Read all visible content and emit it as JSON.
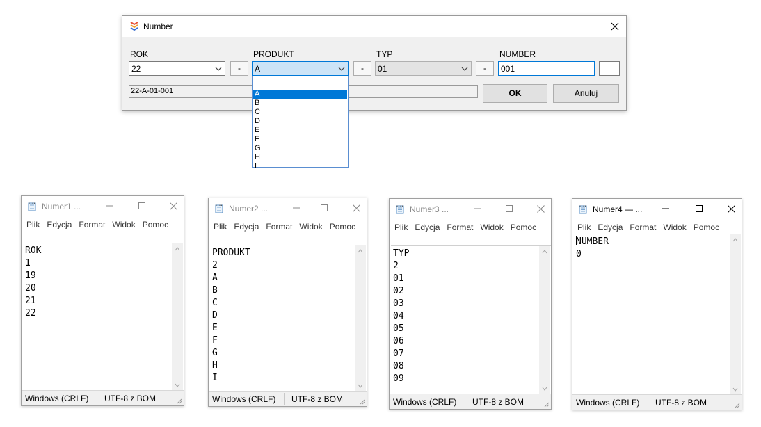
{
  "dialog": {
    "title": "Number",
    "fields": {
      "rok": {
        "label": "ROK",
        "value": "22"
      },
      "produkt": {
        "label": "PRODUKT",
        "value": "A"
      },
      "typ": {
        "label": "TYP",
        "value": "01"
      },
      "number": {
        "label": "NUMBER",
        "value": "001"
      }
    },
    "separator": "-",
    "extra_value": "",
    "preview": "22-A-01-001",
    "ok_label": "OK",
    "cancel_label": "Anuluj",
    "dropdown_options": [
      "",
      "A",
      "B",
      "C",
      "D",
      "E",
      "F",
      "G",
      "H",
      "I"
    ],
    "dropdown_selected": "A"
  },
  "notepads": [
    {
      "title": "Numer1 ...",
      "menu": [
        "Plik",
        "Edycja",
        "Format",
        "Widok",
        "Pomoc"
      ],
      "lines": [
        "ROK",
        "1",
        "19",
        "20",
        "21",
        "22"
      ],
      "status_eol": "Windows (CRLF)",
      "status_enc": "UTF-8 z BOM"
    },
    {
      "title": "Numer2 ...",
      "menu": [
        "Plik",
        "Edycja",
        "Format",
        "Widok",
        "Pomoc"
      ],
      "lines": [
        "PRODUKT",
        "2",
        "A",
        "B",
        "C",
        "D",
        "E",
        "F",
        "G",
        "H",
        "I"
      ],
      "status_eol": "Windows (CRLF)",
      "status_enc": "UTF-8 z BOM"
    },
    {
      "title": "Numer3 ...",
      "menu": [
        "Plik",
        "Edycja",
        "Format",
        "Widok",
        "Pomoc"
      ],
      "lines": [
        "TYP",
        "2",
        "01",
        "02",
        "03",
        "04",
        "05",
        "06",
        "07",
        "08",
        "09"
      ],
      "status_eol": "Windows (CRLF)",
      "status_enc": "UTF-8 z BOM"
    },
    {
      "title": "Numer4 — ...",
      "menu": [
        "Plik",
        "Edycja",
        "Format",
        "Widok",
        "Pomoc"
      ],
      "lines": [
        "NUMBER",
        "0"
      ],
      "status_eol": "Windows (CRLF)",
      "status_enc": "UTF-8 z BOM"
    }
  ]
}
